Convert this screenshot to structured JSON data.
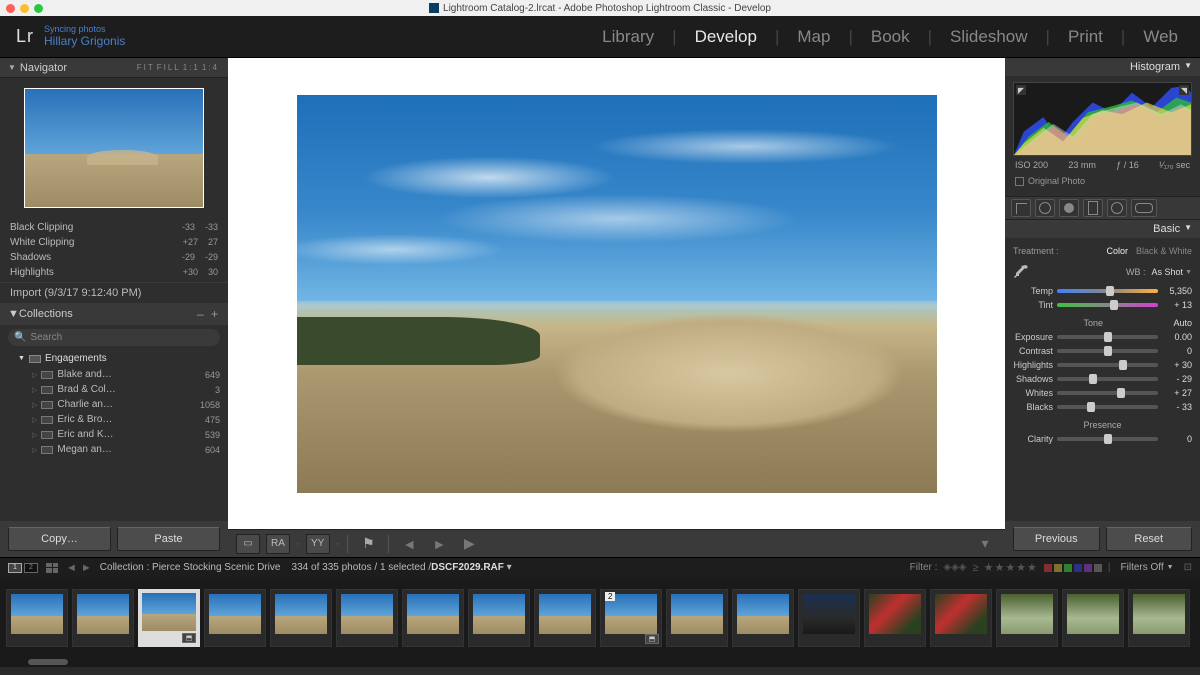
{
  "titlebar": {
    "text": "Lightroom Catalog-2.lrcat - Adobe Photoshop Lightroom Classic - Develop"
  },
  "header": {
    "logo": "Lr",
    "sync": "Syncing photos",
    "user": "Hillary Grigonis",
    "modules": [
      "Library",
      "Develop",
      "Map",
      "Book",
      "Slideshow",
      "Print",
      "Web"
    ],
    "active_module": "Develop"
  },
  "navigator": {
    "title": "Navigator",
    "view_modes": [
      "FIT",
      "FILL",
      "1:1",
      "1:4"
    ]
  },
  "history": {
    "rows": [
      {
        "label": "Black Clipping",
        "v1": "-33",
        "v2": "-33"
      },
      {
        "label": "White Clipping",
        "v1": "+27",
        "v2": "27"
      },
      {
        "label": "Shadows",
        "v1": "-29",
        "v2": "-29"
      },
      {
        "label": "Highlights",
        "v1": "+30",
        "v2": "30"
      }
    ],
    "import": "Import (9/3/17 9:12:40 PM)"
  },
  "collections": {
    "title": "Collections",
    "search_placeholder": "Search",
    "parent": "Engagements",
    "items": [
      {
        "name": "Blake and…",
        "count": "649"
      },
      {
        "name": "Brad & Col…",
        "count": "3"
      },
      {
        "name": "Charlie an…",
        "count": "1058"
      },
      {
        "name": "Eric & Bro…",
        "count": "475"
      },
      {
        "name": "Eric and K…",
        "count": "539"
      },
      {
        "name": "Megan an…",
        "count": "604"
      }
    ]
  },
  "copy_paste": {
    "copy": "Copy…",
    "paste": "Paste"
  },
  "center_toolbar": {
    "opts": [
      "RA",
      "YY"
    ]
  },
  "right": {
    "histogram_title": "Histogram",
    "meta": {
      "iso": "ISO 200",
      "focal": "23 mm",
      "aperture": "ƒ / 16",
      "shutter": "¹⁄₁₇₀ sec"
    },
    "original": "Original Photo",
    "basic_title": "Basic",
    "treatment_label": "Treatment :",
    "color": "Color",
    "bw": "Black & White",
    "wb_label": "WB :",
    "wb_value": "As Shot",
    "temp": {
      "label": "Temp",
      "value": "5,350",
      "pos": 52
    },
    "tint": {
      "label": "Tint",
      "value": "+ 13",
      "pos": 56
    },
    "tone_label": "Tone",
    "auto": "Auto",
    "sliders": [
      {
        "label": "Exposure",
        "value": "0.00",
        "pos": 50
      },
      {
        "label": "Contrast",
        "value": "0",
        "pos": 50
      },
      {
        "label": "Highlights",
        "value": "+ 30",
        "pos": 65
      },
      {
        "label": "Shadows",
        "value": "- 29",
        "pos": 36
      },
      {
        "label": "Whites",
        "value": "+ 27",
        "pos": 63
      },
      {
        "label": "Blacks",
        "value": "- 33",
        "pos": 34
      }
    ],
    "presence_label": "Presence",
    "clarity": {
      "label": "Clarity",
      "value": "0",
      "pos": 50
    },
    "previous": "Previous",
    "reset": "Reset"
  },
  "filmstrip": {
    "collection_prefix": "Collection : ",
    "collection": "Pierce Stocking Scenic Drive",
    "count": "334 of 335 photos / 1 selected /",
    "filename": "DSCF2029.RAF",
    "filter_label": "Filter :",
    "filters_off": "Filters Off",
    "sel_badge": "2"
  }
}
